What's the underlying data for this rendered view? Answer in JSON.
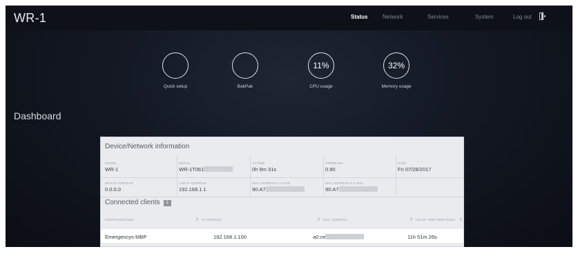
{
  "header": {
    "title": "WR-1",
    "nav": [
      "Status",
      "Network",
      "Services",
      "System",
      "Log out"
    ]
  },
  "tiles": [
    {
      "label": "Quick setup",
      "value": ""
    },
    {
      "label": "BakPak",
      "value": ""
    },
    {
      "label": "CPU usage",
      "value": "11%"
    },
    {
      "label": "Memory usage",
      "value": "32%"
    }
  ],
  "page_title": "Dashboard",
  "device_info": {
    "title": "Device/Network information",
    "fields": [
      {
        "key": "MODEL",
        "value": "WR-1"
      },
      {
        "key": "SERIAL",
        "value": "WR-1T061"
      },
      {
        "key": "UPTIME",
        "value": "0h 9m 31s"
      },
      {
        "key": "FIRMWARE",
        "value": "0.90"
      },
      {
        "key": "DATE",
        "value": "Fri 07/28/2017"
      },
      {
        "key": "WAN IP ADDRESS",
        "value": "0.0.0.0"
      },
      {
        "key": "LAN IP ADDRESS",
        "value": "192.168.1.1"
      },
      {
        "key": "MAC ADDRESS 2.4 GHZ",
        "value": "90:A7"
      },
      {
        "key": "MAC ADDRESS 5.0 GHZ",
        "value": "90:A7"
      }
    ]
  },
  "clients": {
    "title": "Connected clients",
    "count": "1",
    "columns": [
      "HOSTNAME/ZONE",
      "IP ADDRESS",
      "MAC ADDRESS",
      "LEASE TIME REMAINING"
    ],
    "rows": [
      {
        "hostname": "Emergencys-MBP",
        "ip": "192.168.1.100",
        "mac": "a0:ce",
        "lease": "11h 51m 26s"
      }
    ]
  },
  "colors": {
    "background": "#131823",
    "topbar": "#0e1118",
    "panel": "#e9ebee",
    "accent_text": "#ffffff"
  }
}
